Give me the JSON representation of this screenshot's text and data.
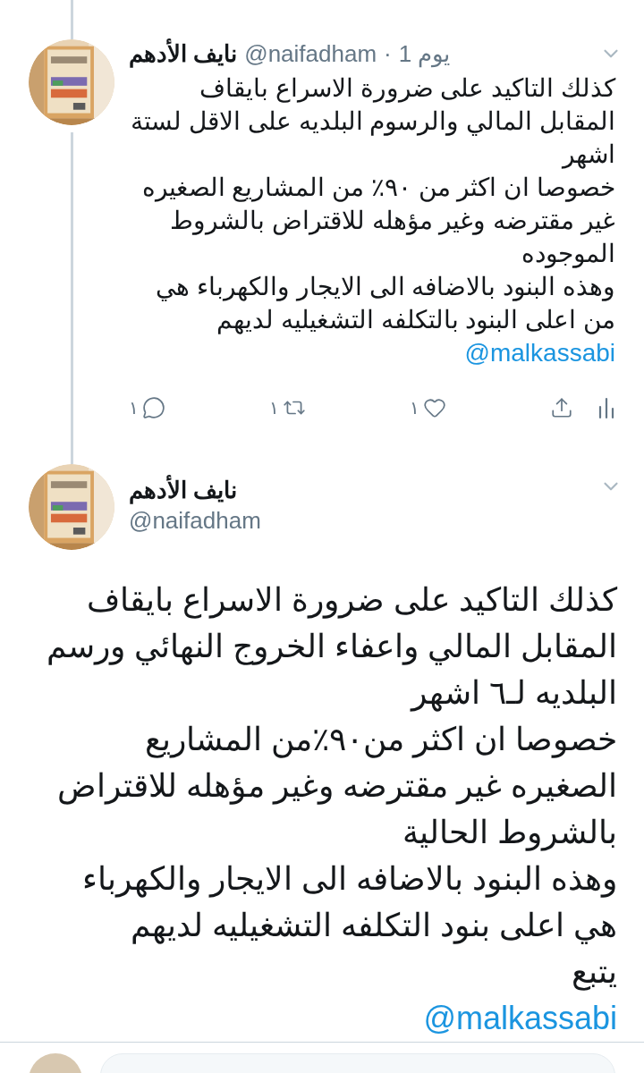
{
  "tweets": [
    {
      "kind": "compact",
      "name": "نايف الأدهم",
      "handle": "@naifadham",
      "separator": "·",
      "time": "1 يوم",
      "paragraphs": [
        "كذلك التاكيد على ضرورة الاسراع بايقاف المقابل المالي والرسوم البلديه على الاقل لستة اشهر",
        "خصوصا ان اكثر من ٩٠٪ من المشاريع الصغيره غير مقترضه وغير مؤهله للاقتراض بالشروط الموجوده",
        "وهذه البنود بالاضافه الى الايجار والكهرباء هي من اعلى البنود بالتكلفه التشغيليه لديهم"
      ],
      "mention": "@malkassabi",
      "actions": {
        "replies": "١",
        "retweets": "١",
        "likes": "١"
      }
    },
    {
      "kind": "expanded",
      "name": "نايف الأدهم",
      "handle": "@naifadham",
      "paragraphs": [
        "كذلك التاكيد على ضرورة الاسراع بايقاف المقابل المالي واعفاء الخروج النهائي ورسم البلديه لـ٦ اشهر",
        "خصوصا ان اكثر من٩٠٪من المشاريع الصغيره غير مقترضه وغير مؤهله للاقتراض بالشروط الحالية",
        "وهذه البنود بالاضافه الى الايجار والكهرباء هي اعلى بنود التكلفه التشغيليه لديهم",
        "يتبع"
      ],
      "mention": "@malkassabi"
    }
  ]
}
